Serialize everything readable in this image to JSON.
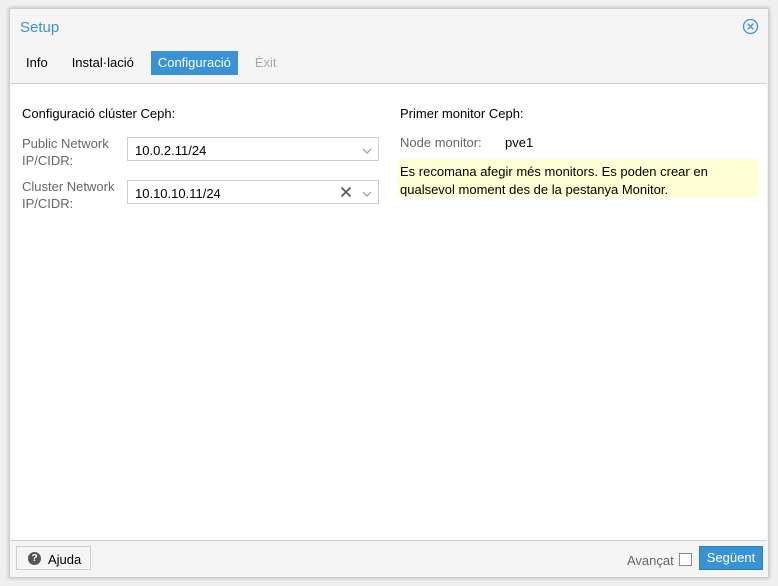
{
  "window": {
    "title": "Setup"
  },
  "tabs": [
    {
      "label": "Info",
      "state": "normal"
    },
    {
      "label": "Instal·lació",
      "state": "normal"
    },
    {
      "label": "Configuració",
      "state": "active"
    },
    {
      "label": "Èxit",
      "state": "disabled"
    }
  ],
  "cluster_config": {
    "heading": "Configuració clúster Ceph:",
    "public_network": {
      "label_line1": "Public Network",
      "label_line2": "IP/CIDR:",
      "value": "10.0.2.11/24"
    },
    "cluster_network": {
      "label_line1": "Cluster Network",
      "label_line2": "IP/CIDR:",
      "value": "10.10.10.11/24"
    }
  },
  "monitor": {
    "heading": "Primer monitor Ceph:",
    "node_label": "Node monitor:",
    "node_value": "pve1",
    "info_line1": "Es recomana afegir més monitors. Es poden crear en",
    "info_line2": "qualsevol moment des de la pestanya Monitor."
  },
  "footer": {
    "help_label": "Ajuda",
    "advanced_label": "Avançat",
    "advanced_checked": false,
    "next_label": "Següent"
  },
  "colors": {
    "accent": "#3892d4",
    "info_bg": "#ffffd6"
  }
}
